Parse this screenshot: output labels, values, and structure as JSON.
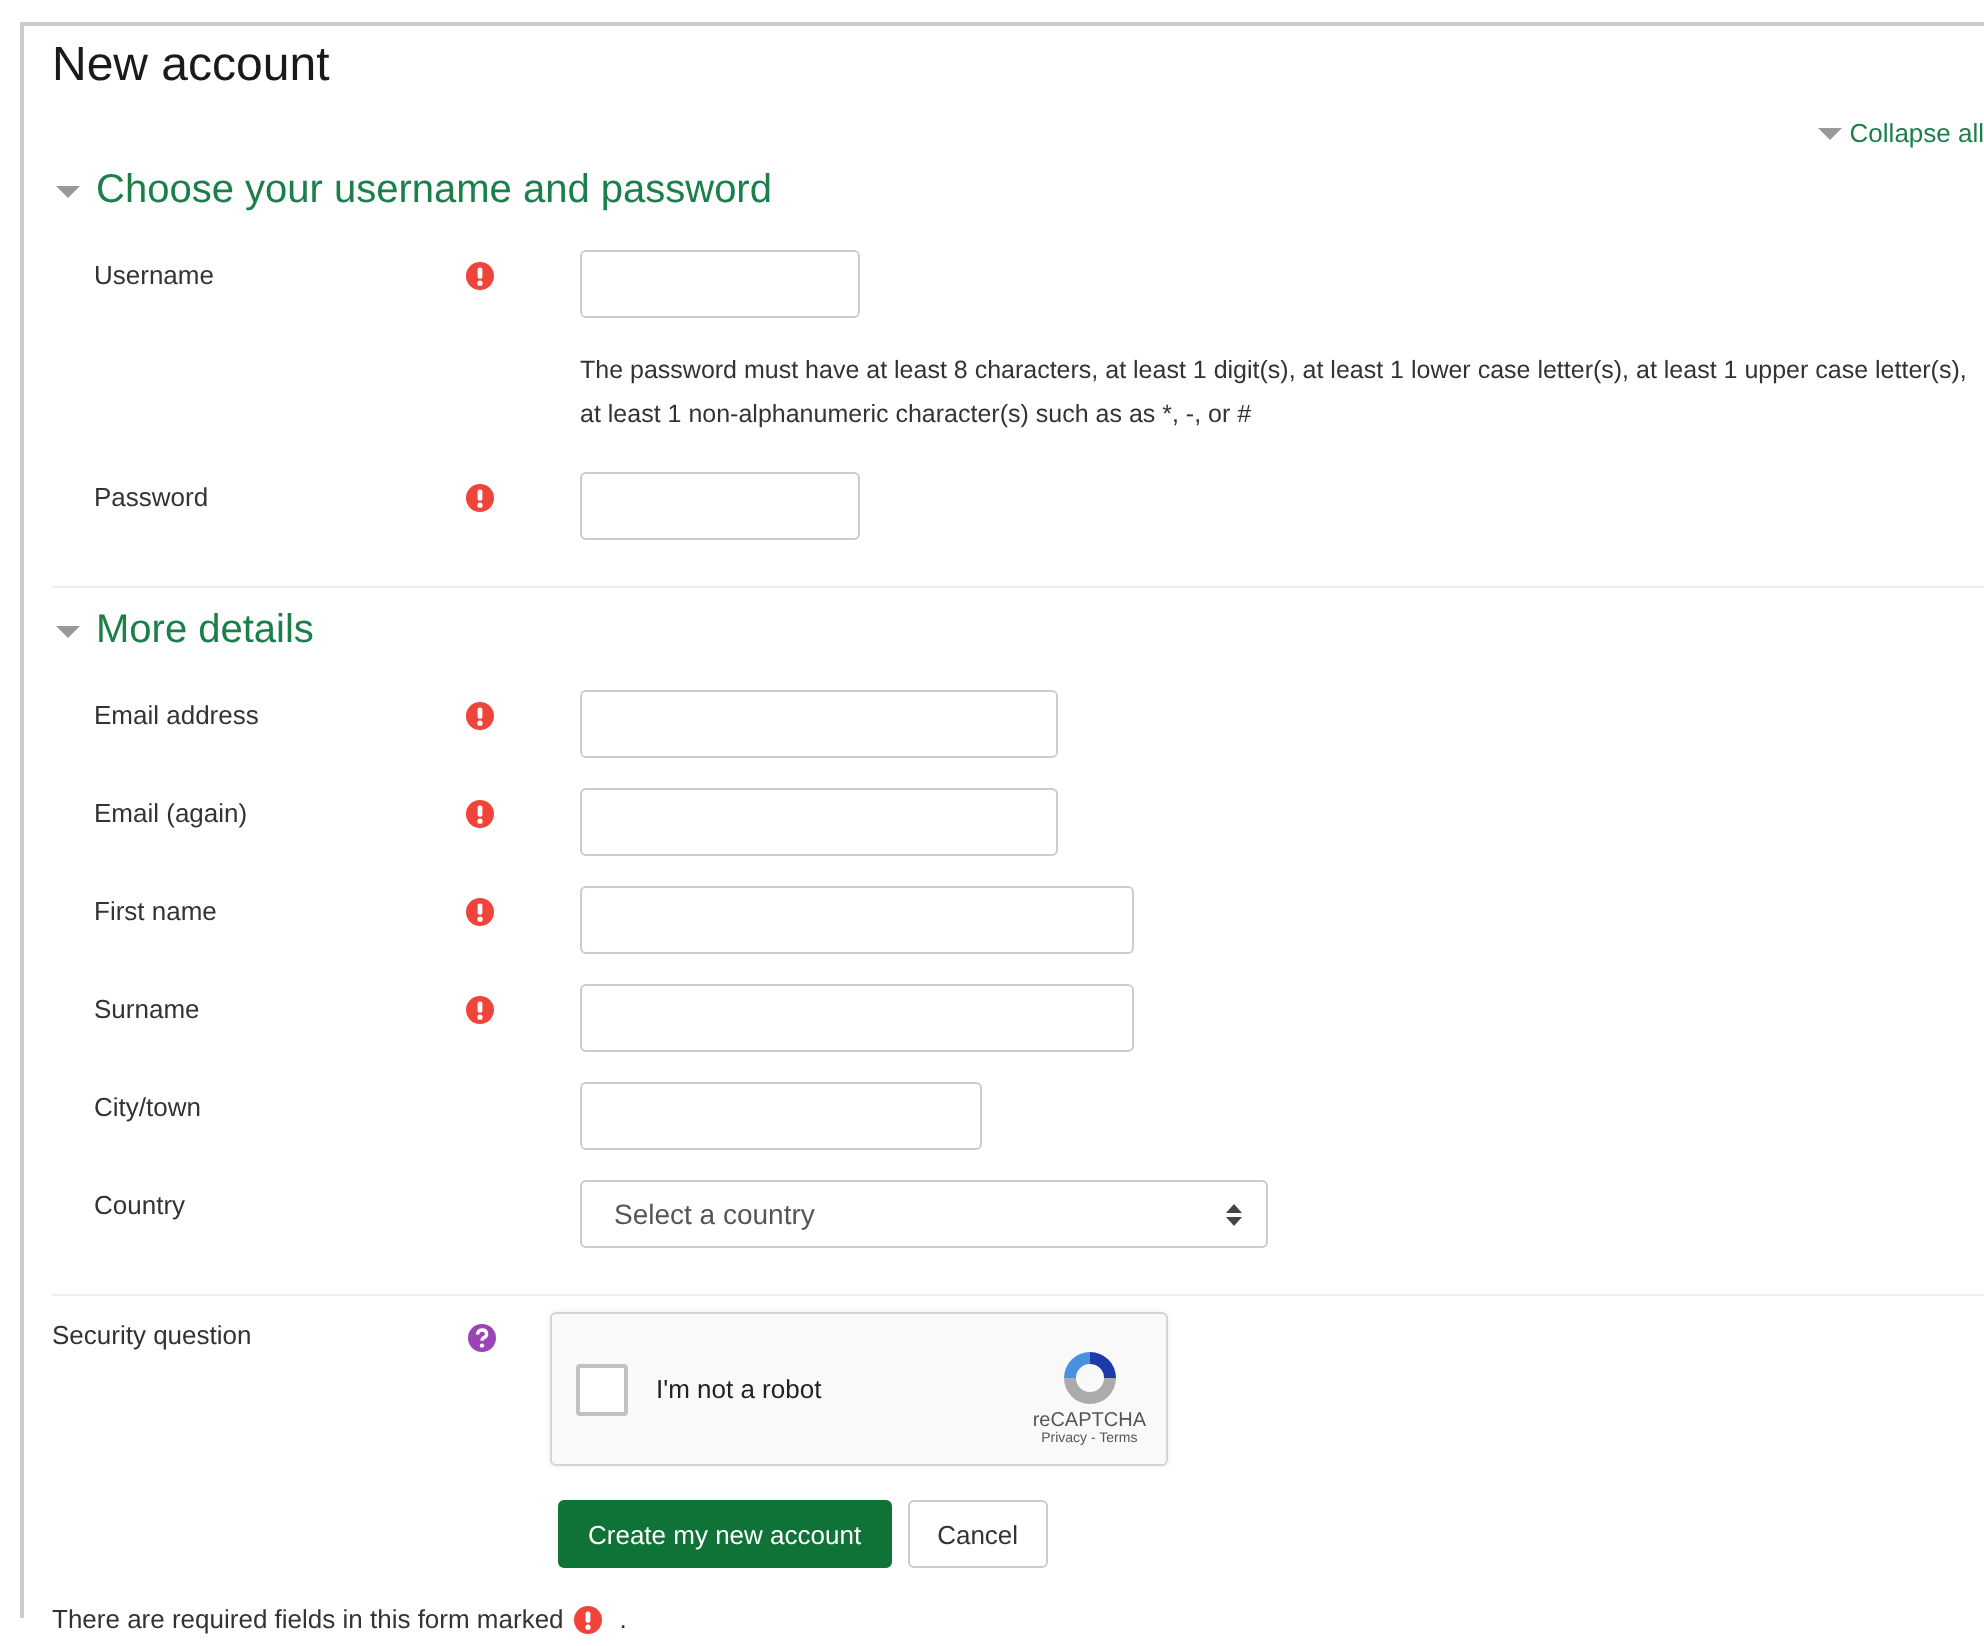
{
  "title": "New account",
  "collapse_all": {
    "label": "Collapse all",
    "expanded": true
  },
  "sections": [
    {
      "heading": "Choose your username and password",
      "expanded": true,
      "fields": [
        {
          "kind": "text",
          "label": "Username",
          "required": true
        },
        {
          "kind": "note",
          "text": "The password must have at least 8 characters, at least 1 digit(s), at least 1 lower case letter(s), at least 1 upper case letter(s), at least 1 non-alphanumeric character(s) such as as *, -, or #"
        },
        {
          "kind": "text",
          "label": "Password",
          "required": true
        }
      ]
    },
    {
      "heading": "More details",
      "expanded": true,
      "fields": [
        {
          "kind": "text",
          "label": "Email address",
          "required": true
        },
        {
          "kind": "text",
          "label": "Email (again)",
          "required": true
        },
        {
          "kind": "text",
          "label": "First name",
          "required": true
        },
        {
          "kind": "text",
          "label": "Surname",
          "required": true
        },
        {
          "kind": "text",
          "label": "City/town",
          "required": false
        },
        {
          "kind": "select",
          "label": "Country",
          "required": false,
          "value": "Select a country"
        }
      ]
    }
  ],
  "security": {
    "label": "Security question",
    "captcha": {
      "checked": false,
      "text": "I'm not a robot",
      "brand": "reCAPTCHA",
      "links": "Privacy - Terms"
    }
  },
  "buttons": [
    {
      "label": "Create my new account",
      "primary": true
    },
    {
      "label": "Cancel",
      "primary": false
    }
  ],
  "footer": {
    "text": "There are required fields in this form marked",
    "end": "."
  }
}
